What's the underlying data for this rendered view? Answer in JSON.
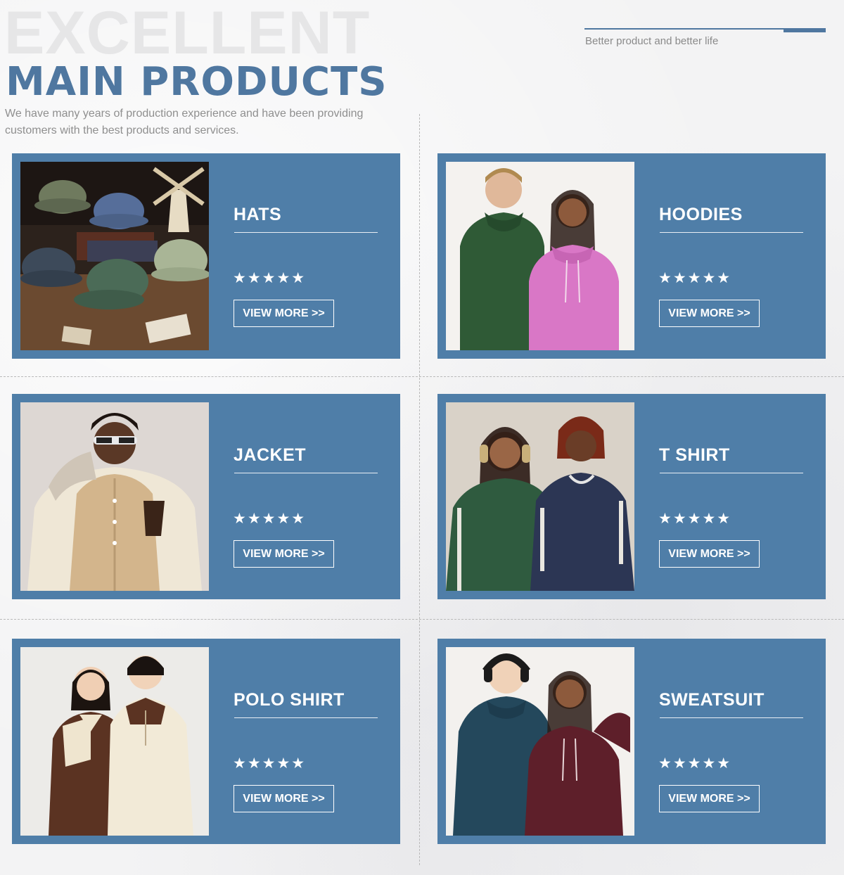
{
  "header": {
    "background_word": "EXCELLENT",
    "title": "MAIN PRODUCTS",
    "intro": "We have many years of production experience and have been providing customers with the best products and services.",
    "tagline": "Better product and better life"
  },
  "colors": {
    "accent": "#4f77a0",
    "card_background": "#4f7ea8",
    "text_on_card": "#ffffff"
  },
  "products": [
    {
      "title": "HATS",
      "stars": "★★★★★",
      "rating": 5,
      "button": "VIEW MORE >>"
    },
    {
      "title": "HOODIES",
      "stars": "★★★★★",
      "rating": 5,
      "button": "VIEW MORE >>"
    },
    {
      "title": "JACKET",
      "stars": "★★★★★",
      "rating": 5,
      "button": "VIEW MORE >>"
    },
    {
      "title": "T SHIRT",
      "stars": "★★★★★",
      "rating": 5,
      "button": "VIEW MORE >>"
    },
    {
      "title": "POLO SHIRT",
      "stars": "★★★★★",
      "rating": 5,
      "button": "VIEW MORE >>"
    },
    {
      "title": "SWEATSUIT",
      "stars": "★★★★★",
      "rating": 5,
      "button": "VIEW MORE >>"
    }
  ]
}
